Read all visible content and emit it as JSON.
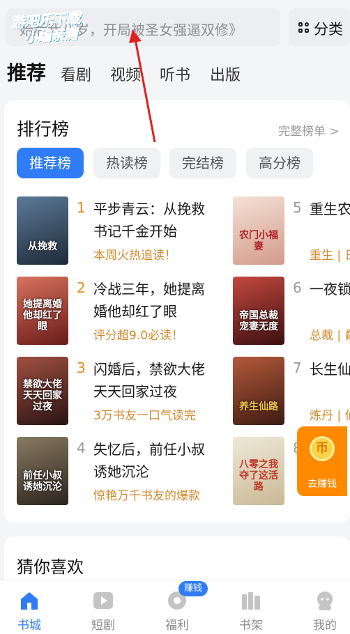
{
  "search": {
    "placeholder": "《重生后我八岁，开局被圣女强逼双修》",
    "visible_text": "始后我八岁，开局被圣女强逼双修》"
  },
  "watermark": {
    "line1": "游吧乐下载",
    "line2": "小编亲测"
  },
  "category": {
    "label": "分类",
    "icon": "grid-icon"
  },
  "topnav": {
    "tabs": [
      "推荐",
      "看剧",
      "视频",
      "听书",
      "出版"
    ],
    "active": 0
  },
  "ranking": {
    "title": "排行榜",
    "more": "完整榜单 >",
    "chips": [
      "推荐榜",
      "热读榜",
      "完结榜",
      "高分榜"
    ],
    "active_chip": 0,
    "books": [
      {
        "rank": "1",
        "title": "平步青云：从挽救书记千金开始",
        "tag": "本周火热追读！",
        "cover_text": "从挽救",
        "cover_color": "#3a4a5c"
      },
      {
        "rank": "2",
        "title": "冷战三年，她提离婚他却红了眼",
        "tag": "评分超9.0必读！",
        "cover_text": "她提离婚他却红了眼",
        "cover_color": "#b8423a"
      },
      {
        "rank": "3",
        "title": "闪婚后，禁欲大佬天天回家过夜",
        "tag": "3万书友一口气读完",
        "cover_text": "禁欲大佬天天回家过夜",
        "cover_color": "#5a2a2a"
      },
      {
        "rank": "4",
        "title": "失忆后，前任小叔诱她沉沦",
        "tag": "惊艳万千书友的爆款",
        "cover_text": "前任小叔诱她沉沦",
        "cover_color": "#3f3a32"
      },
      {
        "rank": "5",
        "title": "重生农",
        "tag": "重生 | 日",
        "cover_text": "农门小福妻",
        "cover_color": "#e6c9b8"
      },
      {
        "rank": "6",
        "title": "一夜锁裁宠妻",
        "tag": "总裁 | 鹬",
        "cover_text": "帝国总裁宠妻无度",
        "cover_color": "#b73a3a"
      },
      {
        "rank": "7",
        "title": "长生仙道兄妻",
        "tag": "炼丹 | 仙",
        "cover_text": "养生仙路",
        "cover_color": "#7a3a2a"
      },
      {
        "rank": "8",
        "title": "",
        "tag": "",
        "cover_text": "八零之我夺了这活路",
        "cover_color": "#d9d2c0"
      }
    ]
  },
  "earn": {
    "label": "去赚钱",
    "icon": "coin-icon"
  },
  "guess": {
    "title": "猜你喜欢"
  },
  "tabbar": {
    "tabs": [
      {
        "label": "书城",
        "icon": "home-icon"
      },
      {
        "label": "短剧",
        "icon": "play-icon"
      },
      {
        "label": "福利",
        "icon": "gift-icon"
      },
      {
        "label": "书架",
        "icon": "shelf-icon"
      },
      {
        "label": "我的",
        "icon": "profile-icon"
      }
    ],
    "active": 0,
    "badge": "赚钱"
  },
  "colors": {
    "accent": "#2f7cf6",
    "rank_top": "#e08b1e",
    "tag": "#d08a2c",
    "earn": "#ff8a00",
    "annotation": "#e02020"
  }
}
